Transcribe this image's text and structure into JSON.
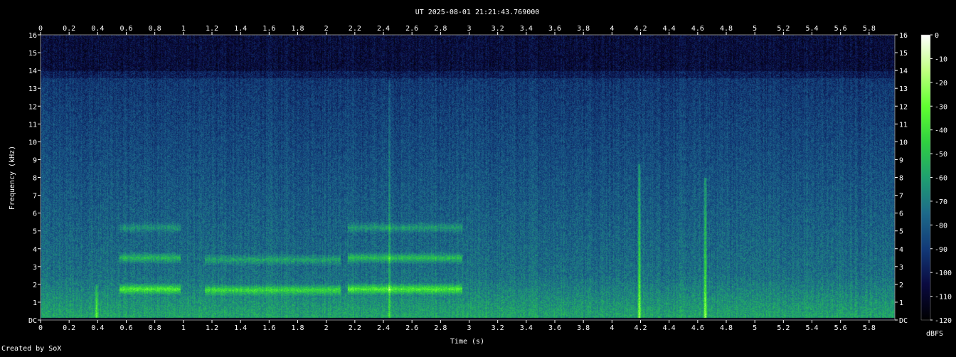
{
  "chart_data": {
    "type": "heatmap",
    "title": "UT 2025-08-01 21:21:43.769000",
    "xlabel": "Time (s)",
    "ylabel": "Frequency (kHz)",
    "xlim": [
      0,
      5.98
    ],
    "ylim": [
      0,
      16
    ],
    "x_ticks": [
      "0",
      "0.2",
      "0.4",
      "0.6",
      "0.8",
      "1",
      "1.2",
      "1.4",
      "1.6",
      "1.8",
      "2",
      "2.2",
      "2.4",
      "2.6",
      "2.8",
      "3",
      "3.2",
      "3.4",
      "3.6",
      "3.8",
      "4",
      "4.2",
      "4.4",
      "4.6",
      "4.8",
      "5",
      "5.2",
      "5.4",
      "5.6",
      "5.8"
    ],
    "y_ticks": [
      "DC",
      "1",
      "2",
      "3",
      "4",
      "5",
      "6",
      "7",
      "8",
      "9",
      "10",
      "11",
      "12",
      "13",
      "14",
      "15",
      "16"
    ],
    "colorbar": {
      "label": "dBFS",
      "ticks": [
        "0",
        "-10",
        "-20",
        "-30",
        "-40",
        "-50",
        "-60",
        "-70",
        "-80",
        "-90",
        "-100",
        "-110",
        "-120"
      ],
      "range": [
        -120,
        0
      ]
    },
    "colormap_stops": [
      "#000000",
      "#0a0a40",
      "#123a78",
      "#1d6a8a",
      "#1fa070",
      "#30d040",
      "#60ff30",
      "#c0ff80",
      "#ffffff"
    ],
    "events": [
      {
        "kind": "harmonic",
        "t_start": 0.55,
        "t_end": 0.98,
        "f_khz": 1.75,
        "level": 0.8
      },
      {
        "kind": "harmonic",
        "t_start": 0.55,
        "t_end": 0.98,
        "f_khz": 3.5,
        "level": 0.55
      },
      {
        "kind": "harmonic",
        "t_start": 0.55,
        "t_end": 0.98,
        "f_khz": 5.2,
        "level": 0.35
      },
      {
        "kind": "harmonic",
        "t_start": 1.15,
        "t_end": 2.1,
        "f_khz": 1.7,
        "level": 0.65
      },
      {
        "kind": "harmonic",
        "t_start": 1.15,
        "t_end": 2.1,
        "f_khz": 3.4,
        "level": 0.4
      },
      {
        "kind": "harmonic",
        "t_start": 2.15,
        "t_end": 2.95,
        "f_khz": 1.75,
        "level": 0.8
      },
      {
        "kind": "harmonic",
        "t_start": 2.15,
        "t_end": 2.95,
        "f_khz": 3.5,
        "level": 0.6
      },
      {
        "kind": "harmonic",
        "t_start": 2.15,
        "t_end": 2.95,
        "f_khz": 5.2,
        "level": 0.4
      },
      {
        "kind": "click",
        "t": 0.39,
        "f_max_khz": 2.0,
        "level": 0.7
      },
      {
        "kind": "click",
        "t": 2.44,
        "f_max_khz": 13.5,
        "level": 0.5
      },
      {
        "kind": "click",
        "t": 4.19,
        "f_max_khz": 8.8,
        "level": 0.85
      },
      {
        "kind": "click",
        "t": 4.65,
        "f_max_khz": 8.0,
        "level": 0.9
      }
    ]
  },
  "credit": "Created by SoX"
}
